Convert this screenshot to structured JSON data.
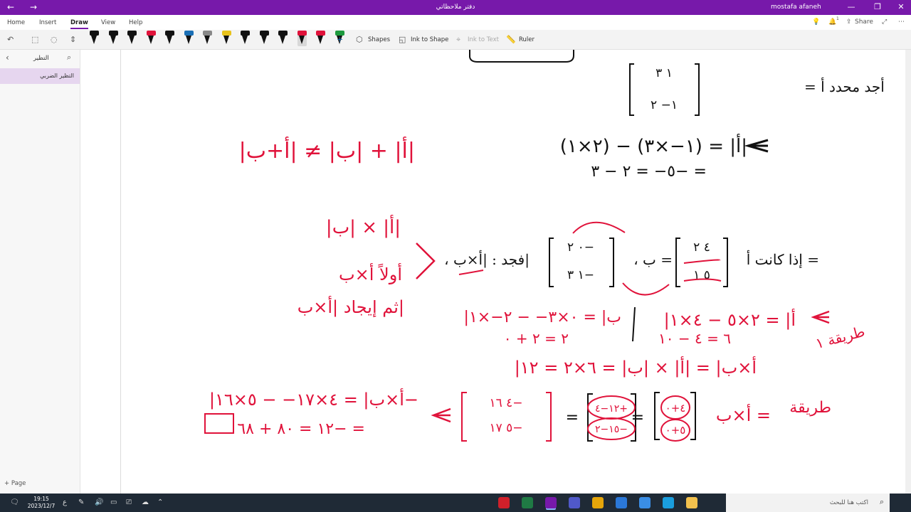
{
  "titlebar": {
    "back": "←",
    "forward": "→",
    "title": "دفتر ملاحظاتي",
    "user": "mostafa afaneh",
    "minimize": "—",
    "restore": "❐",
    "close": "✕"
  },
  "ribbon": {
    "tabs": [
      "Home",
      "Insert",
      "Draw",
      "View",
      "Help"
    ],
    "active_tab": "Draw",
    "share": "Share",
    "notifications_count": "1"
  },
  "toolbar": {
    "shapes": "Shapes",
    "ink_to_shape": "Ink to Shape",
    "ink_to_text": "Ink to Text",
    "ruler": "Ruler",
    "pen_colors": [
      "#111111",
      "#111111",
      "#111111",
      "#e0123a",
      "#111111",
      "#1a6fb5",
      "#888888",
      "#e8c21a",
      "#111111",
      "#111111",
      "#111111",
      "#e0123a",
      "#e0123a",
      "#1d9a3e"
    ]
  },
  "sidebar": {
    "section_title": "التظير",
    "page_title": "التظير الضربي",
    "add_page": "Page"
  },
  "note": {
    "q1_text": "أجد محدد  أ =",
    "q1_matrix": [
      "١    ٣",
      "١−    ٢"
    ],
    "q1_step1": "(٢×١) − (١−×٣) = |أ|",
    "q1_step2": "٥− = ٢ − ٣− =",
    "prop_note": "|أ| + |ب| ≠ |أ+ب|",
    "q2_text": "إذا كانت أ =",
    "q2_text2": "، ب =",
    "q2_text3": "، فجد : |أ×ب|",
    "q2_matrix_a": [
      "٤    ٢",
      "٥    ١"
    ],
    "q2_matrix_b": [
      "٠    ٢−",
      "١    ٣−"
    ],
    "side_1": "|أ| × |ب|",
    "side_2": "أولاً أ×ب",
    "side_3": "ثم إيجاد |أ×ب|",
    "method1_label": "طريقة ١",
    "method1_a": "|أ| = ٢×٥ − ٤×١",
    "method1_a2": "٦ = ٤ − ١٠",
    "method1_b": "|ب| = ٠×٣− − ٢−×١",
    "method1_b2": "٢ = ٢ + ٠",
    "method1_result": "|أ×ب| = |أ| × |ب| = ٦×٢ = ١٢",
    "method2_label": "طريقة",
    "method2_lhs": "أ×ب =",
    "method2_m1": [
      "٤+٠",
      "٥+٠"
    ],
    "method2_m2": [
      "١٢−٤+",
      "١٥−٢−"
    ],
    "method2_m3": [
      "٤    ١٦−",
      "٥    ١٧−"
    ],
    "method2_det": "|أ×ب| = ٤×١٧− − ٥×١٦−",
    "method2_det2": "١٢ = ٨٠ + ٦٨− ="
  },
  "taskbar": {
    "time": "19:15",
    "date": "2023/12/7",
    "search_placeholder": "اكتب هنا للبحث",
    "apps": [
      {
        "name": "opera",
        "color": "#d0202a"
      },
      {
        "name": "excel",
        "color": "#1f7a44"
      },
      {
        "name": "onenote",
        "color": "#7719aa"
      },
      {
        "name": "teams",
        "color": "#5059c9"
      },
      {
        "name": "chrome",
        "color": "#e5a50a"
      },
      {
        "name": "mail",
        "color": "#2b78d8"
      },
      {
        "name": "store",
        "color": "#3a8ee6"
      },
      {
        "name": "edge",
        "color": "#1a9ede"
      },
      {
        "name": "explorer",
        "color": "#f2c14e"
      }
    ]
  }
}
